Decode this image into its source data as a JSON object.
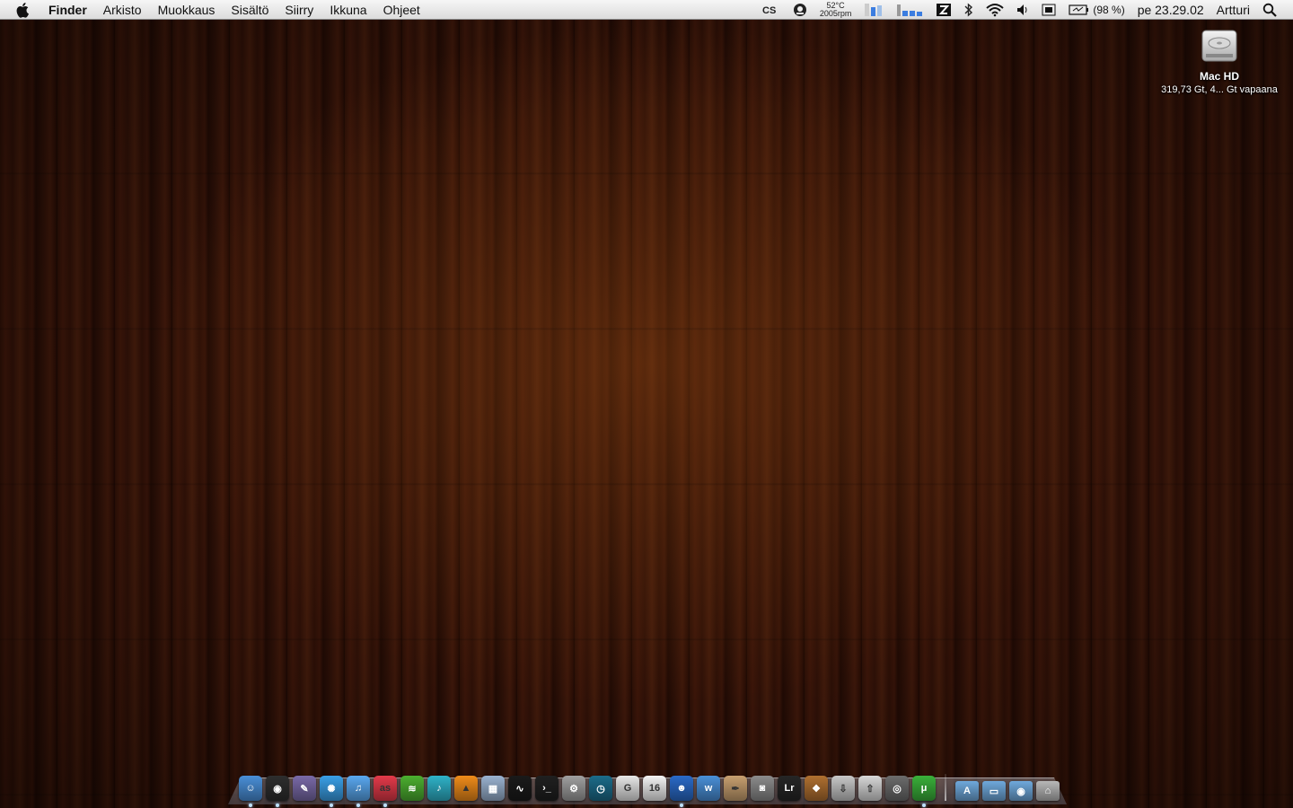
{
  "menubar": {
    "app": "Finder",
    "menus": [
      "Arkisto",
      "Muokkaus",
      "Sisältö",
      "Siirry",
      "Ikkuna",
      "Ohjeet"
    ],
    "status": {
      "temp": "52°C",
      "rpm": "2005rpm",
      "battery": "(98 %)",
      "clock": "pe 23.29.02",
      "user": "Artturi"
    },
    "icons": [
      "apple-icon",
      "lastfm-scrobbler-icon",
      "istat-icon",
      "memory-monitor-icon",
      "disk-usage-icon",
      "dropbox-icon",
      "bluetooth-icon",
      "wifi-icon",
      "volume-icon",
      "input-menu-icon",
      "battery-icon",
      "spotlight-icon"
    ]
  },
  "desktop": {
    "drive": {
      "name": "Mac HD",
      "info": "319,73 Gt, 4... Gt vapaana"
    }
  },
  "dock": {
    "apps": [
      {
        "name": "finder",
        "color": "#4a8fd8",
        "glyph": "☺"
      },
      {
        "name": "dashboard",
        "color": "#2e2e2e",
        "glyph": "◉"
      },
      {
        "name": "preview",
        "color": "#7a6aa8",
        "glyph": "✎"
      },
      {
        "name": "safari",
        "color": "#3aa0e8",
        "glyph": "✺"
      },
      {
        "name": "itunes",
        "color": "#5aa8f0",
        "glyph": "♫"
      },
      {
        "name": "lastfm",
        "color": "#e43a4a",
        "glyph": "as"
      },
      {
        "name": "spotify",
        "color": "#4caf30",
        "glyph": "≋"
      },
      {
        "name": "music",
        "color": "#2fb3c9",
        "glyph": "♪"
      },
      {
        "name": "vlc",
        "color": "#f08c1a",
        "glyph": "▲"
      },
      {
        "name": "spaces",
        "color": "#9ab2d0",
        "glyph": "▦"
      },
      {
        "name": "activity-monitor",
        "color": "#1a1a1a",
        "glyph": "∿"
      },
      {
        "name": "terminal",
        "color": "#202020",
        "glyph": "›_"
      },
      {
        "name": "automator",
        "color": "#a0a0a0",
        "glyph": "⚙"
      },
      {
        "name": "time-machine",
        "color": "#1c6c8a",
        "glyph": "◷"
      },
      {
        "name": "ical-gmail",
        "color": "#e8e8e8",
        "glyph": "G"
      },
      {
        "name": "calendar",
        "color": "#f4f4f4",
        "glyph": "16"
      },
      {
        "name": "adium",
        "color": "#2a6ac8",
        "glyph": "☻"
      },
      {
        "name": "wunderkit",
        "color": "#4a90d8",
        "glyph": "w"
      },
      {
        "name": "textedit",
        "color": "#c8a070",
        "glyph": "✒"
      },
      {
        "name": "screenshot",
        "color": "#8c8c8c",
        "glyph": "◙"
      },
      {
        "name": "lightroom",
        "color": "#262626",
        "glyph": "Lr"
      },
      {
        "name": "iphoto",
        "color": "#b07030",
        "glyph": "❖"
      },
      {
        "name": "downloads-app",
        "color": "#c8c8c8",
        "glyph": "⇩"
      },
      {
        "name": "flickr-uploadr",
        "color": "#d8d8d8",
        "glyph": "⇧"
      },
      {
        "name": "image-capture",
        "color": "#6c6c6c",
        "glyph": "◎"
      },
      {
        "name": "utorrent",
        "color": "#3ab03a",
        "glyph": "μ"
      }
    ],
    "stacks": [
      {
        "name": "applications-folder",
        "color": "#6fa9dc",
        "glyph": "A"
      },
      {
        "name": "documents-folder",
        "color": "#6fa9dc",
        "glyph": "▭"
      },
      {
        "name": "downloads-folder",
        "color": "#6fa9dc",
        "glyph": "◉"
      },
      {
        "name": "trash",
        "color": "#b8b8b8",
        "glyph": "⌂"
      }
    ]
  }
}
